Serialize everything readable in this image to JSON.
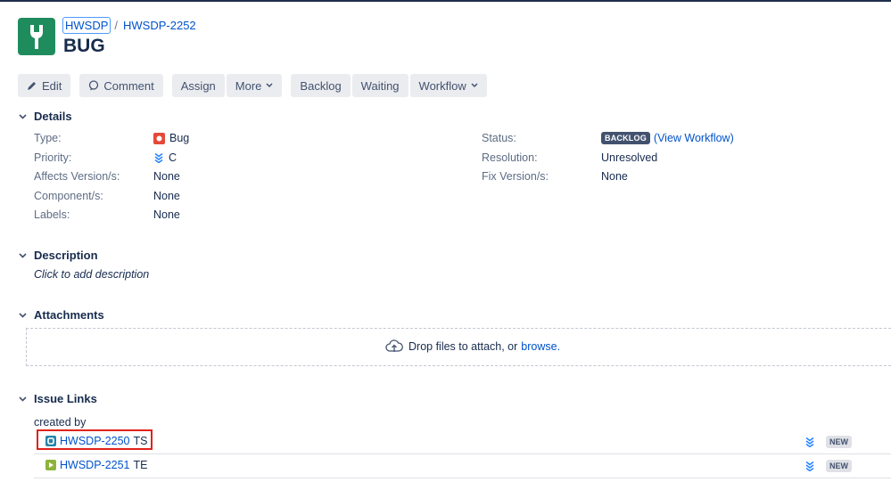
{
  "header": {
    "project_key": "HWSDP",
    "separator": "/",
    "issue_key": "HWSDP-2252",
    "summary": "BUG"
  },
  "toolbar": {
    "edit": "Edit",
    "comment": "Comment",
    "assign": "Assign",
    "more": "More",
    "backlog": "Backlog",
    "waiting": "Waiting",
    "workflow": "Workflow"
  },
  "details": {
    "heading": "Details",
    "type_label": "Type:",
    "type_value": "Bug",
    "priority_label": "Priority:",
    "priority_value": "C",
    "affects_label": "Affects Version/s:",
    "affects_value": "None",
    "component_label": "Component/s:",
    "component_value": "None",
    "labels_label": "Labels:",
    "labels_value": "None",
    "status_label": "Status:",
    "status_value": "BACKLOG",
    "view_workflow": "(View Workflow)",
    "resolution_label": "Resolution:",
    "resolution_value": "Unresolved",
    "fix_label": "Fix Version/s:",
    "fix_value": "None"
  },
  "description": {
    "heading": "Description",
    "placeholder": "Click to add description"
  },
  "attachments": {
    "heading": "Attachments",
    "drop_text": "Drop files to attach, or",
    "browse": "browse."
  },
  "issue_links": {
    "heading": "Issue Links",
    "relation": "created by",
    "items": [
      {
        "key": "HWSDP-2250",
        "summary": "TS",
        "status": "NEW"
      },
      {
        "key": "HWSDP-2251",
        "summary": "TE",
        "status": "NEW"
      }
    ]
  },
  "colors": {
    "link": "#0052cc",
    "project_avatar": "#1f8c5d",
    "bug_icon": "#e5493a",
    "highlight": "#e0231c"
  },
  "icons": [
    "pencil-icon",
    "comment-icon",
    "chevron-down-icon",
    "bug-icon",
    "priority-lowest-icon",
    "cloud-upload-icon",
    "issue-type-icon"
  ]
}
